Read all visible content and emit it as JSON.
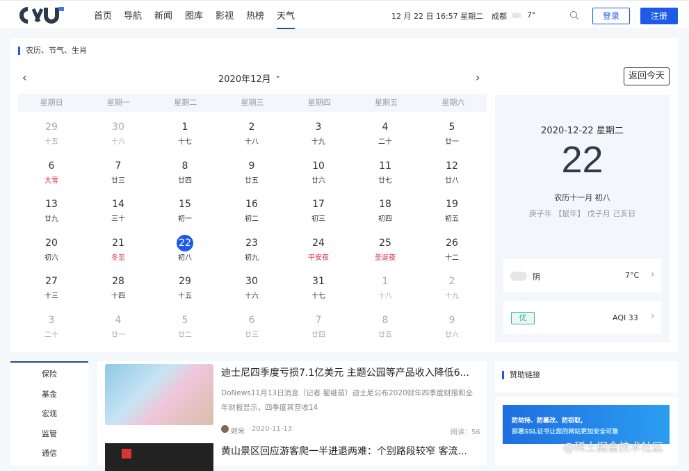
{
  "header": {
    "logo_text": "CXU",
    "nav": [
      "首页",
      "导航",
      "新闻",
      "图库",
      "影视",
      "热榜",
      "天气"
    ],
    "active_nav": 6,
    "datetime": "12 月 22 日 16:57 星期二",
    "city": "成都",
    "temp": "7°",
    "login": "登录",
    "register": "注册"
  },
  "calendar": {
    "section_title": "农历、节气、生肖",
    "month_label": "2020年12月",
    "return_today": "返回今天",
    "weekdays": [
      "星期日",
      "星期一",
      "星期二",
      "星期三",
      "星期四",
      "星期五",
      "星期六"
    ],
    "days": [
      {
        "n": "29",
        "l": "十五",
        "o": 1
      },
      {
        "n": "30",
        "l": "十六",
        "o": 1
      },
      {
        "n": "1",
        "l": "十七"
      },
      {
        "n": "2",
        "l": "十八"
      },
      {
        "n": "3",
        "l": "十九"
      },
      {
        "n": "4",
        "l": "二十"
      },
      {
        "n": "5",
        "l": "廿一"
      },
      {
        "n": "6",
        "l": "大雪",
        "r": 1
      },
      {
        "n": "7",
        "l": "廿三"
      },
      {
        "n": "8",
        "l": "廿四"
      },
      {
        "n": "9",
        "l": "廿五"
      },
      {
        "n": "10",
        "l": "廿六"
      },
      {
        "n": "11",
        "l": "廿七"
      },
      {
        "n": "12",
        "l": "廿八"
      },
      {
        "n": "13",
        "l": "廿九"
      },
      {
        "n": "14",
        "l": "三十"
      },
      {
        "n": "15",
        "l": "初一"
      },
      {
        "n": "16",
        "l": "初二"
      },
      {
        "n": "17",
        "l": "初三"
      },
      {
        "n": "18",
        "l": "初四"
      },
      {
        "n": "19",
        "l": "初五"
      },
      {
        "n": "20",
        "l": "初六"
      },
      {
        "n": "21",
        "l": "冬至",
        "r": 1
      },
      {
        "n": "22",
        "l": "初八",
        "t": 1
      },
      {
        "n": "23",
        "l": "初九"
      },
      {
        "n": "24",
        "l": "平安夜",
        "r": 1
      },
      {
        "n": "25",
        "l": "圣诞夜",
        "r": 1
      },
      {
        "n": "26",
        "l": "十二"
      },
      {
        "n": "27",
        "l": "十三"
      },
      {
        "n": "28",
        "l": "十四"
      },
      {
        "n": "29",
        "l": "十五"
      },
      {
        "n": "30",
        "l": "十六"
      },
      {
        "n": "31",
        "l": "十七"
      },
      {
        "n": "1",
        "l": "十八",
        "o": 1
      },
      {
        "n": "2",
        "l": "十九",
        "o": 1
      },
      {
        "n": "3",
        "l": "二十",
        "o": 1
      },
      {
        "n": "4",
        "l": "廿一",
        "o": 1
      },
      {
        "n": "5",
        "l": "廿二",
        "o": 1
      },
      {
        "n": "6",
        "l": "廿三",
        "o": 1
      },
      {
        "n": "7",
        "l": "廿四",
        "o": 1
      },
      {
        "n": "8",
        "l": "廿五",
        "o": 1
      },
      {
        "n": "9",
        "l": "廿六",
        "o": 1
      }
    ]
  },
  "today": {
    "date": "2020-12-22 星期二",
    "day": "22",
    "lunar": "农历十一月 初八",
    "ganzhi": "庚子年 【鼠年】 戊子月 己亥日",
    "weather": "阴",
    "weather_temp": "7°C",
    "aqi_badge": "优",
    "aqi": "AQI 33"
  },
  "categories": [
    "保险",
    "基金",
    "宏观",
    "监管",
    "通信"
  ],
  "news": [
    {
      "title": "迪士尼四季度亏损7.1亿美元 主题公园等产品收入降低6...",
      "summary": "DoNews11月13日消息（记者 翟继茹）迪士尼公布2020财年四季度财报和全年财报显示，四季度其营收14",
      "author": "姬米",
      "date": "2020-11-13",
      "reads": "阅读：56"
    },
    {
      "title": "黄山景区回应游客爬一半进退两难：个别路段较窄 客流..."
    }
  ],
  "sponsor": {
    "title": "赞助链接",
    "ad_line1": "防劫持、防篡改、防窃取,",
    "ad_line2": "部署SSL证书让您的网站更加安全可靠"
  },
  "watermark": "@稀土掘金技术社区"
}
